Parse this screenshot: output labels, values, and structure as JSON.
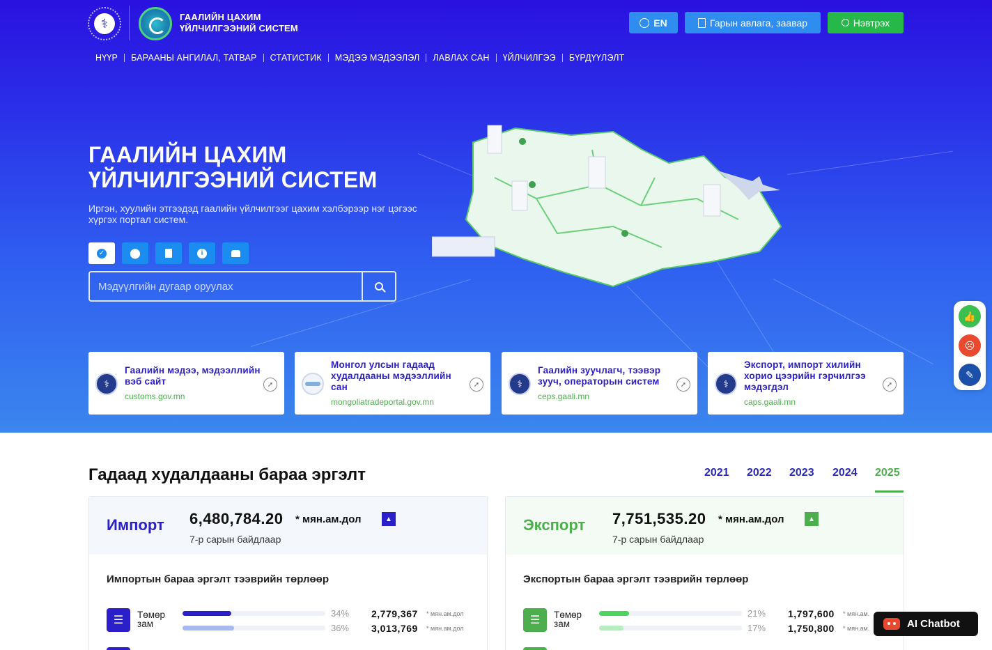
{
  "header": {
    "brand_line1": "ГААЛИЙН ЦАХИМ",
    "brand_line2": "ҮЙЛЧИЛГЭЭНИЙ СИСТЕМ",
    "lang_label": "EN",
    "guide_label": "Гарын авлага, заавар",
    "login_label": "Нэвтрэх"
  },
  "nav": {
    "items": [
      "НҮҮР",
      "БАРААНЫ АНГИЛАЛ, ТАТВАР",
      "СТАТИСТИК",
      "МЭДЭЭ МЭДЭЭЛЭЛ",
      "ЛАВЛАХ САН",
      "ҮЙЛЧИЛГЭЭ",
      "БҮРДҮҮЛЭЛТ"
    ]
  },
  "hero": {
    "title_line1": "ГААЛИЙН ЦАХИМ",
    "title_line2": "ҮЙЛЧИЛГЭЭНИЙ СИСТЕМ",
    "subtitle": "Иргэн, хуулийн этгээдэд гаалийн үйлчилгээг цахим хэлбэрээр нэг цэгээс хүргэх портал систем.",
    "search_placeholder": "Мэдүүлгийн дугаар оруулах"
  },
  "link_cards": [
    {
      "title": "Гаалийн мэдээ, мэдээллийн вэб сайт",
      "url": "customs.gov.mn"
    },
    {
      "title": "Монгол улсын гадаад худалдааны мэдээллийн сан",
      "url": "mongoliatradeportal.gov.mn"
    },
    {
      "title": "Гаалийн зуучлагч, тээвэр зууч, операторын систем",
      "url": "ceps.gaali.mn"
    },
    {
      "title": "Экспорт, импорт хилийн хорио цээрийн гэрчилгээ мэдэгдэл",
      "url": "caps.gaali.mn"
    }
  ],
  "trade": {
    "title": "Гадаад худалдааны бараа эргэлт",
    "years": [
      "2021",
      "2022",
      "2023",
      "2024",
      "2025"
    ],
    "active_year": "2025",
    "import": {
      "name": "Импорт",
      "value": "6,480,784.20",
      "unit": "* мян.ам.дол",
      "note": "7-р сарын байдлаар",
      "subtitle": "Импортын бараа эргэлт тээврийн төрлөөр",
      "row_label_1": "Төмөр",
      "row_label_2": "зам",
      "pct_1": "34%",
      "pct_2": "36%",
      "pct_1_value": 34,
      "pct_2_value": 36,
      "amt_1": "2,779,367",
      "amt_2": "3,013,769",
      "small_unit": "* мян.ам.дол",
      "color": "#2a1fc9"
    },
    "export": {
      "name": "Экспорт",
      "value": "7,751,535.20",
      "unit": "* мян.ам.дол",
      "note": "7-р сарын байдлаар",
      "subtitle": "Экспортын бараа эргэлт тээврийн төрлөөр",
      "row_label_1": "Төмөр",
      "row_label_2": "зам",
      "pct_1": "21%",
      "pct_2": "17%",
      "pct_1_value": 21,
      "pct_2_value": 17,
      "amt_1": "1,797,600",
      "amt_2": "1,750,800",
      "small_unit": "* мян.ам.",
      "color": "#4cae4c"
    }
  },
  "chatbot_label": "AI Chatbot",
  "colors": {
    "hero_top": "#2a11e0",
    "hero_bottom": "#3b86ee",
    "accent_blue": "#2f8df0",
    "accent_green": "#27b84a",
    "import_color": "#2a1fc9",
    "export_color": "#4cae4c"
  }
}
